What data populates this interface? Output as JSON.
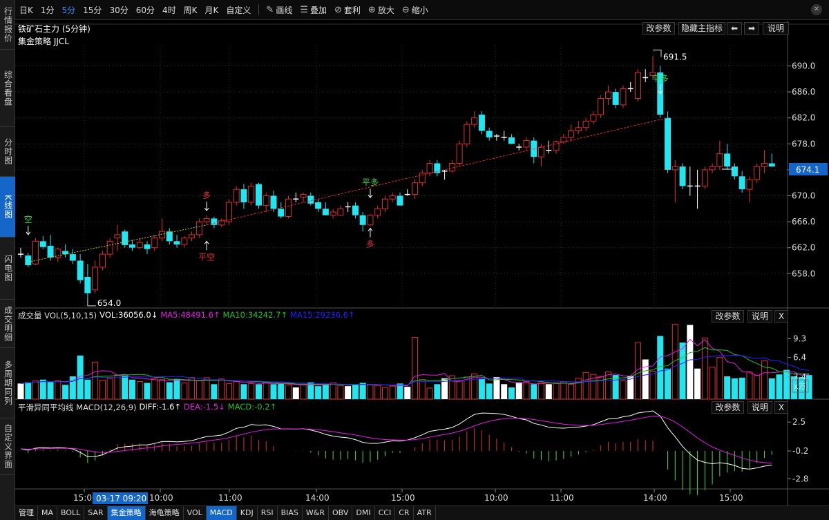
{
  "sidebar": {
    "tabs": [
      {
        "label": "行情报价",
        "active": false
      },
      {
        "label": "综合看盘",
        "active": false
      },
      {
        "label": "分时图",
        "active": false
      },
      {
        "label": "K线图",
        "active": true
      },
      {
        "label": "闪电图",
        "active": false
      },
      {
        "label": "成交明细",
        "active": false
      },
      {
        "label": "多周期同列",
        "active": false
      },
      {
        "label": "自定义界面",
        "active": false
      }
    ]
  },
  "toolbar": {
    "periods": [
      {
        "label": "日K",
        "active": false
      },
      {
        "label": "1分",
        "active": false
      },
      {
        "label": "5分",
        "active": true
      },
      {
        "label": "15分",
        "active": false
      },
      {
        "label": "30分",
        "active": false
      },
      {
        "label": "60分",
        "active": false
      },
      {
        "label": "4时",
        "active": false
      },
      {
        "label": "周K",
        "active": false
      },
      {
        "label": "月K",
        "active": false
      },
      {
        "label": "自定义",
        "active": false
      }
    ],
    "draw_label": "画线",
    "overlay_label": "叠加",
    "arbitrage_label": "套利",
    "zoom_in_label": "放大",
    "zoom_out_label": "缩小"
  },
  "main_panel": {
    "title": "铁矿石主力 (5分钟)",
    "strategy": "集金策略 JJCL",
    "buttons": {
      "params": "改参数",
      "hide": "隐藏主指标",
      "help": "说明"
    },
    "high_label": "691.5",
    "low_label": "654.0",
    "current_price": "674.1",
    "y_axis": [
      "690.0",
      "686.0",
      "682.0",
      "678.0",
      "674.0",
      "670.0",
      "666.0",
      "662.0",
      "658.0"
    ],
    "signals": [
      {
        "text": "空",
        "color": "#3fcf3f"
      },
      {
        "text": "多",
        "color": "#e03030"
      },
      {
        "text": "平空",
        "color": "#e03030"
      },
      {
        "text": "平多",
        "color": "#3fcf3f"
      },
      {
        "text": "多",
        "color": "#e03030"
      },
      {
        "text": "平多",
        "color": "#3fcf3f"
      }
    ]
  },
  "volume_panel": {
    "title": "成交量 VOL(5,10,15)",
    "vol": "VOL:36056.0↓",
    "ma5": "MA5:48491.6↑",
    "ma10": "MA10:34242.7↑",
    "ma15": "MA15:29236.6↑",
    "buttons": {
      "params": "改参数",
      "help": "说明",
      "close": "X"
    },
    "y_axis": [
      "9.3",
      "6.4",
      "3.4"
    ],
    "unit": "x万"
  },
  "macd_panel": {
    "title": "平滑异同平均线 MACD(12,26,9)",
    "diff": "DIFF:-1.6↑",
    "dea": "DEA:-1.5↓",
    "macd": "MACD:-0.2↑",
    "buttons": {
      "params": "改参数",
      "help": "说明",
      "close": "X"
    },
    "y_axis": [
      "2.5",
      "-0.2",
      "-2.8"
    ]
  },
  "time_axis": {
    "labels": [
      "15:00",
      "10:00",
      "11:00",
      "14:00",
      "15:00",
      "10:00",
      "11:00",
      "14:00",
      "15:00"
    ],
    "cursor": "03-17 09:20"
  },
  "bottom_tabs": [
    {
      "label": "管理",
      "active": false
    },
    {
      "label": "MA",
      "active": false
    },
    {
      "label": "BOLL",
      "active": false
    },
    {
      "label": "SAR",
      "active": false
    },
    {
      "label": "集金策略",
      "active": true
    },
    {
      "label": "海龟策略",
      "active": false
    },
    {
      "label": "VOL",
      "active": false
    },
    {
      "label": "MACD",
      "active": true
    },
    {
      "label": "KDJ",
      "active": false
    },
    {
      "label": "RSI",
      "active": false
    },
    {
      "label": "BIAS",
      "active": false
    },
    {
      "label": "W&R",
      "active": false
    },
    {
      "label": "OBV",
      "active": false
    },
    {
      "label": "DMI",
      "active": false
    },
    {
      "label": "CCI",
      "active": false
    },
    {
      "label": "CR",
      "active": false
    },
    {
      "label": "ATR",
      "active": false
    }
  ],
  "colors": {
    "up": "#e03030",
    "down": "#22e5f0",
    "ma5": "#e020e0",
    "ma10": "#22c22a",
    "ma15": "#2222ff",
    "diff": "#ffffff",
    "dea": "#e020e0",
    "accent": "#1467c8"
  },
  "chart_data": {
    "type": "candlestick",
    "symbol": "铁矿石主力",
    "period": "5分钟",
    "price_range": [
      654.0,
      691.5
    ],
    "current": 674.1,
    "candles": [
      [
        661.2,
        662.0,
        660.5,
        661.0
      ],
      [
        660.8,
        661.2,
        659.0,
        659.3
      ],
      [
        659.5,
        663.5,
        659.3,
        663.0
      ],
      [
        663.0,
        663.8,
        661.8,
        662.1
      ],
      [
        662.3,
        664.0,
        660.0,
        660.5
      ],
      [
        660.5,
        662.0,
        659.8,
        661.8
      ],
      [
        661.5,
        662.5,
        660.5,
        661.0
      ],
      [
        661.0,
        661.8,
        659.5,
        660.0
      ],
      [
        660.0,
        661.0,
        656.5,
        657.0
      ],
      [
        657.5,
        659.5,
        654.0,
        655.0
      ],
      [
        655.5,
        660.0,
        655.0,
        659.0
      ],
      [
        659.0,
        661.5,
        658.5,
        661.0
      ],
      [
        661.0,
        663.5,
        660.5,
        663.0
      ],
      [
        663.5,
        665.5,
        661.5,
        664.0
      ],
      [
        664.5,
        664.8,
        662.0,
        662.4
      ],
      [
        662.5,
        663.2,
        661.5,
        662.0
      ],
      [
        662.0,
        663.5,
        661.8,
        662.8
      ],
      [
        662.5,
        663.0,
        661.0,
        661.8
      ],
      [
        662.0,
        664.0,
        661.5,
        663.5
      ],
      [
        663.5,
        666.5,
        663.0,
        664.5
      ],
      [
        664.5,
        665.0,
        662.5,
        663.0
      ],
      [
        663.0,
        664.0,
        662.0,
        662.5
      ],
      [
        662.5,
        663.8,
        662.0,
        663.5
      ],
      [
        663.5,
        664.5,
        663.0,
        664.0
      ],
      [
        664.0,
        666.5,
        663.5,
        666.0
      ],
      [
        666.0,
        667.0,
        665.5,
        666.5
      ],
      [
        666.5,
        666.8,
        665.0,
        665.5
      ],
      [
        665.5,
        666.5,
        665.2,
        666.2
      ],
      [
        666.0,
        669.5,
        665.5,
        669.0
      ],
      [
        669.0,
        671.5,
        668.5,
        671.0
      ],
      [
        671.0,
        671.8,
        668.0,
        669.0
      ],
      [
        669.0,
        672.0,
        668.5,
        671.5
      ],
      [
        671.8,
        672.0,
        668.0,
        668.5
      ],
      [
        668.5,
        670.5,
        667.5,
        670.0
      ],
      [
        670.0,
        670.8,
        667.5,
        668.0
      ],
      [
        668.0,
        669.0,
        666.5,
        666.8
      ],
      [
        666.8,
        670.0,
        666.5,
        669.5
      ],
      [
        669.5,
        670.5,
        669.0,
        669.5
      ],
      [
        669.8,
        670.5,
        669.0,
        670.2
      ],
      [
        670.0,
        670.5,
        668.5,
        668.8
      ],
      [
        669.0,
        669.5,
        667.5,
        668.0
      ],
      [
        668.0,
        669.0,
        667.0,
        667.0
      ],
      [
        667.0,
        668.0,
        666.5,
        667.5
      ],
      [
        667.0,
        668.5,
        667.0,
        668.0
      ],
      [
        668.0,
        669.0,
        667.5,
        668.3
      ],
      [
        668.5,
        669.0,
        666.5,
        667.0
      ],
      [
        667.0,
        667.5,
        664.5,
        665.5
      ],
      [
        665.5,
        667.2,
        665.3,
        667.0
      ],
      [
        667.0,
        668.5,
        666.5,
        668.0
      ],
      [
        668.0,
        670.0,
        667.5,
        669.5
      ],
      [
        669.5,
        670.5,
        669.0,
        670.0
      ],
      [
        670.0,
        670.5,
        668.5,
        668.5
      ],
      [
        670.5,
        671.0,
        670.0,
        670.2
      ],
      [
        670.2,
        672.5,
        669.5,
        672.0
      ],
      [
        672.0,
        674.0,
        671.5,
        673.5
      ],
      [
        673.5,
        675.5,
        673.0,
        675.0
      ],
      [
        675.0,
        675.5,
        673.0,
        673.5
      ],
      [
        673.5,
        674.0,
        672.5,
        673.8
      ],
      [
        673.8,
        675.5,
        673.5,
        675.0
      ],
      [
        675.0,
        678.5,
        674.5,
        678.0
      ],
      [
        678.0,
        681.5,
        677.5,
        681.0
      ],
      [
        681.0,
        683.0,
        680.5,
        682.0
      ],
      [
        682.5,
        683.0,
        679.5,
        680.0
      ],
      [
        680.0,
        680.5,
        678.5,
        679.0
      ],
      [
        679.0,
        679.5,
        678.5,
        679.2
      ],
      [
        679.2,
        680.0,
        678.5,
        679.0
      ],
      [
        679.0,
        679.5,
        678.0,
        678.0
      ],
      [
        677.5,
        678.0,
        677.0,
        677.5
      ],
      [
        677.5,
        679.0,
        677.0,
        678.5
      ],
      [
        678.5,
        679.0,
        675.0,
        676.0
      ],
      [
        676.0,
        678.0,
        674.5,
        677.5
      ],
      [
        677.0,
        678.5,
        676.5,
        677.0
      ],
      [
        677.0,
        678.5,
        676.5,
        678.3
      ],
      [
        678.3,
        679.5,
        678.0,
        679.0
      ],
      [
        679.0,
        681.0,
        678.5,
        680.0
      ],
      [
        680.0,
        681.5,
        679.5,
        680.5
      ],
      [
        680.5,
        682.0,
        680.0,
        681.5
      ],
      [
        681.5,
        683.0,
        681.0,
        682.5
      ],
      [
        682.5,
        685.5,
        682.0,
        685.0
      ],
      [
        685.0,
        687.0,
        684.0,
        686.0
      ],
      [
        686.0,
        686.5,
        683.5,
        684.0
      ],
      [
        684.0,
        687.0,
        683.5,
        686.5
      ],
      [
        686.5,
        687.5,
        686.0,
        686.5
      ],
      [
        685.0,
        689.5,
        684.5,
        689.0
      ],
      [
        688.0,
        689.5,
        687.5,
        688.2
      ],
      [
        688.5,
        691.5,
        688.0,
        689.0
      ],
      [
        689.0,
        690.0,
        682.0,
        682.5
      ],
      [
        682.0,
        683.0,
        673.5,
        674.0
      ],
      [
        674.0,
        675.5,
        669.0,
        674.5
      ],
      [
        674.5,
        675.0,
        671.0,
        671.5
      ],
      [
        671.5,
        674.5,
        670.0,
        671.5
      ],
      [
        671.5,
        674.0,
        668.0,
        671.5
      ],
      [
        671.5,
        674.5,
        671.0,
        674.0
      ],
      [
        674.0,
        675.0,
        673.5,
        674.5
      ],
      [
        674.5,
        678.5,
        674.0,
        676.5
      ],
      [
        676.5,
        678.0,
        674.0,
        674.5
      ],
      [
        674.5,
        675.0,
        672.5,
        673.0
      ],
      [
        673.0,
        673.8,
        670.5,
        671.0
      ],
      [
        671.0,
        673.0,
        669.0,
        672.5
      ],
      [
        672.5,
        675.0,
        672.0,
        674.5
      ],
      [
        674.5,
        677.0,
        673.5,
        675.0
      ],
      [
        675.0,
        676.5,
        674.5,
        674.5
      ]
    ],
    "volume_wan": [
      2.4,
      2.6,
      2.8,
      3.0,
      2.6,
      2.8,
      2.2,
      3.5,
      6.7,
      3.0,
      5.7,
      2.9,
      3.2,
      3.7,
      3.6,
      3.0,
      2.7,
      2.5,
      3.2,
      3.0,
      2.6,
      3.1,
      2.5,
      3.3,
      2.8,
      3.3,
      2.3,
      3.1,
      2.4,
      2.7,
      2.3,
      2.4,
      2.3,
      2.6,
      2.3,
      2.4,
      2.2,
      1.8,
      2.2,
      2.6,
      2.0,
      2.3,
      2.5,
      2.1,
      2.0,
      2.3,
      2.5,
      2.2,
      2.1,
      1.8,
      2.0,
      2.4,
      1.9,
      9.5,
      3.0,
      1.7,
      2.3,
      3.2,
      3.6,
      2.8,
      3.4,
      3.9,
      3.2,
      2.4,
      3.4,
      2.3,
      1.8,
      2.6,
      2.7,
      2.3,
      2.5,
      2.3,
      2.4,
      2.7,
      2.3,
      3.2,
      4.1,
      3.8,
      3.5,
      4.2,
      3.7,
      2.8,
      3.6,
      8.7,
      6.1,
      4.3,
      9.7,
      4.7,
      11.5,
      8.7,
      11.4,
      4.7,
      9.4,
      4.9,
      6.4,
      3.5,
      3.2,
      3.3,
      4.2,
      3.7,
      5.9,
      3.2,
      3.8,
      4.5,
      3.5,
      3.4,
      3.7
    ]
  }
}
